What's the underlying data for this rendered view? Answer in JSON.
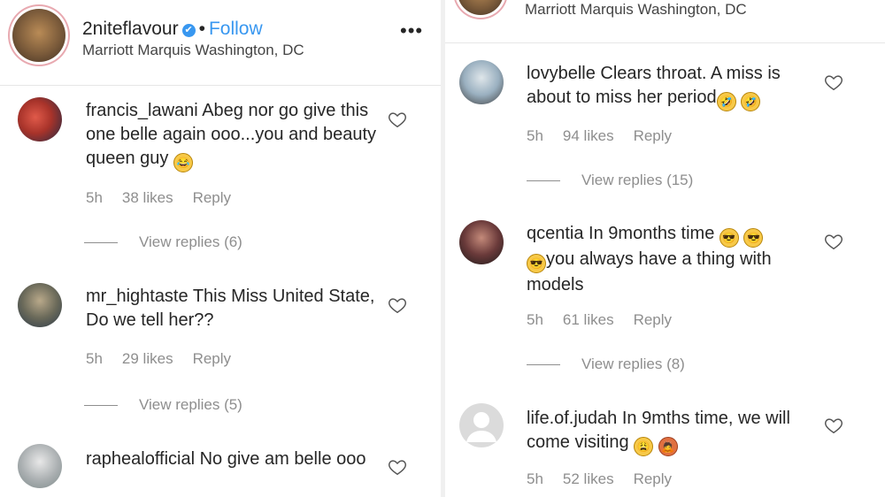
{
  "left": {
    "post_user": "2niteflavour",
    "verified_icon": "✔",
    "dot": "•",
    "follow_label": "Follow",
    "location": "Marriott Marquis Washington, DC",
    "more_icon": "•••",
    "comments": [
      {
        "user": "francis_lawani",
        "text": " Abeg nor go give this one belle again ooo...you and beauty queen guy",
        "emojis": [
          "😂"
        ],
        "time": "5h",
        "likes": "38 likes",
        "reply": "Reply",
        "view_replies": "View replies (6)",
        "avatar_color": "#c0392b"
      },
      {
        "user": "mr_hightaste",
        "text": " This Miss United State, Do we tell her??",
        "emojis": [],
        "time": "5h",
        "likes": "29 likes",
        "reply": "Reply",
        "view_replies": "View replies (5)",
        "avatar_color": "#5a5a4a"
      },
      {
        "user": "raphealofficial",
        "text": " No give am belle ooo",
        "emojis": [],
        "avatar_color": "#9aa0a0"
      }
    ]
  },
  "right": {
    "location": "Marriott Marquis Washington, DC",
    "comments": [
      {
        "user": "lovybelle",
        "text": " Clears throat. A miss is about to miss her period",
        "emojis": [
          "🤣",
          "🤣"
        ],
        "time": "5h",
        "likes": "94 likes",
        "reply": "Reply",
        "view_replies": "View replies (15)",
        "avatar_color": "#9ab0c0"
      },
      {
        "user": "qcentia",
        "text_a": " In 9months time ",
        "text_b": "you always have a thing with models",
        "emojis": [
          "😎",
          "😎",
          "😎"
        ],
        "time": "5h",
        "likes": "61 likes",
        "reply": "Reply",
        "view_replies": "View replies (8)",
        "avatar_color": "#6a3a3a"
      },
      {
        "user": "life.of.judah",
        "text": " In 9mths time, we will come visiting",
        "emojis": [
          "😩",
          "🙇"
        ],
        "time": "5h",
        "likes": "52 likes",
        "reply": "Reply",
        "avatar_color": "#d4d4d4"
      }
    ]
  }
}
